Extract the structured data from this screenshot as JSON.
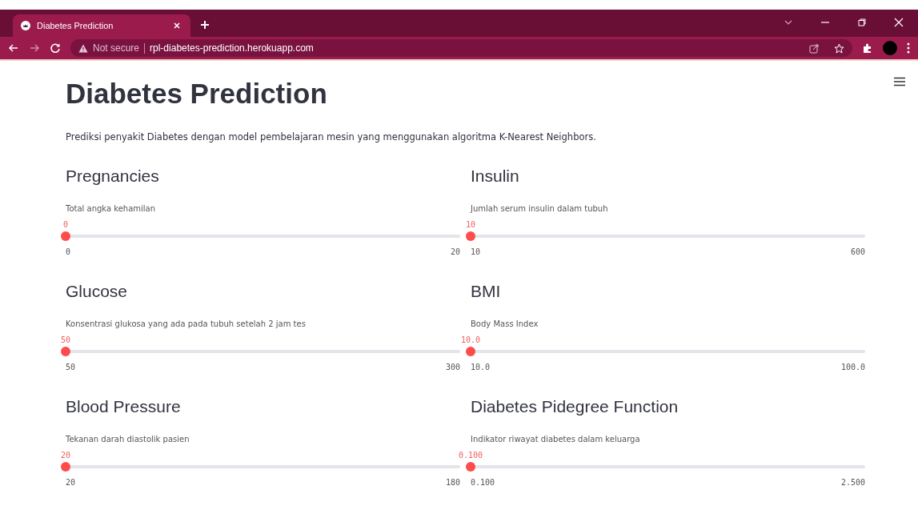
{
  "browser": {
    "tab_title": "Diabetes Prediction",
    "security": "Not secure",
    "url": "rpl-diabetes-prediction.herokuapp.com"
  },
  "page": {
    "title": "Diabetes Prediction",
    "description": "Prediksi penyakit Diabetes dengan model pembelajaran mesin yang menggunakan algoritma K-Nearest Neighbors."
  },
  "sliders": [
    {
      "heading": "Pregnancies",
      "caption": "Total angka kehamilan",
      "value": "0",
      "min": "0",
      "max": "20",
      "level": 0
    },
    {
      "heading": "Insulin",
      "caption": "Jumlah serum insulin dalam tubuh",
      "value": "10",
      "min": "10",
      "max": "600",
      "level": 0
    },
    {
      "heading": "Glucose",
      "caption": "Konsentrasi glukosa yang ada pada tubuh setelah 2 jam tes",
      "value": "50",
      "min": "50",
      "max": "300",
      "level": 0
    },
    {
      "heading": "BMI",
      "caption": "Body Mass Index",
      "value": "10.0",
      "min": "10.0",
      "max": "100.0",
      "level": 0
    },
    {
      "heading": "Blood Pressure",
      "caption": "Tekanan darah diastolik pasien",
      "value": "20",
      "min": "20",
      "max": "180",
      "level": 0
    },
    {
      "heading": "Diabetes Pidegree Function",
      "caption": "Indikator riwayat diabetes dalam keluarga",
      "value": "0.100",
      "min": "0.100",
      "max": "2.500",
      "level": 0
    }
  ]
}
